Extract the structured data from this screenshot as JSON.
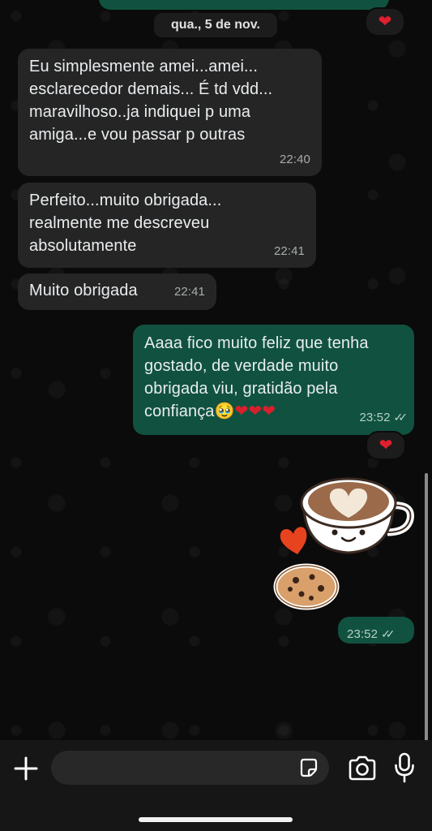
{
  "date_separator": "qua., 5 de nov.",
  "messages": [
    {
      "text": "Eu simplesmente amei...amei... esclarecedor demais... É td vdd... maravilhoso..ja indiquei p uma amiga...e vou passar p outras",
      "time": "22:40",
      "direction": "incoming"
    },
    {
      "text": "Perfeito...muito obrigada... realmente me descreveu absolutamente",
      "time": "22:41",
      "direction": "incoming"
    },
    {
      "text": "Muito obrigada",
      "time": "22:41",
      "direction": "incoming"
    },
    {
      "text": "Aaaa fico muito feliz que tenha gostado, de verdade muito obrigada viu, gratidão pela confiança",
      "emoji": "🥹",
      "hearts": "❤❤❤",
      "time": "23:52",
      "direction": "outgoing",
      "status": "read"
    },
    {
      "type": "sticker",
      "sticker_name": "coffee-cup-and-cookie",
      "time": "23:52",
      "direction": "outgoing",
      "status": "read"
    }
  ],
  "reactions": {
    "top": "❤",
    "message_4": "❤"
  },
  "read_ticks": "✓✓",
  "composer": {
    "value": "",
    "placeholder": ""
  },
  "icons": [
    "plus-icon",
    "sticker-icon",
    "camera-icon",
    "microphone-icon"
  ],
  "colors": {
    "incoming_bubble": "#252525",
    "outgoing_bubble": "#10523f",
    "background": "#0b0b0b"
  }
}
